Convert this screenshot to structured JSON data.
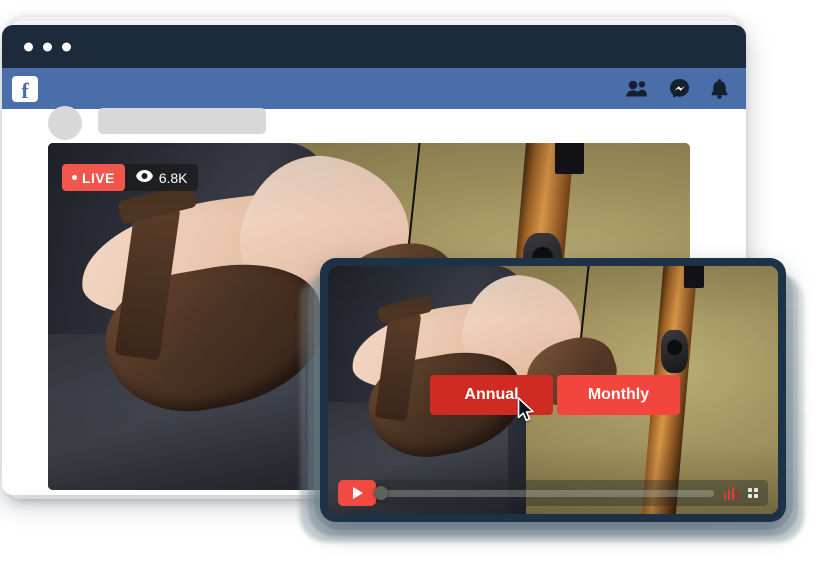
{
  "browser": {
    "window_controls": [
      "dot-1",
      "dot-2",
      "dot-3"
    ],
    "facebook_bar": {
      "logo_letter": "f",
      "icons": [
        "friends-icon",
        "messenger-icon",
        "notifications-bell-icon"
      ]
    },
    "skeleton": {
      "avatar": "avatar-placeholder",
      "name_bar": "name-placeholder"
    },
    "video": {
      "live_badge": {
        "label": "LIVE",
        "indicator": "live-dot",
        "color": "#f2554b"
      },
      "views": {
        "icon": "eye-icon",
        "count": "6.8K"
      },
      "alt": "archer-holding-bow-and-arrow"
    }
  },
  "device": {
    "bezel_color": "#1d3246",
    "video": {
      "alt": "archer-holding-bow-and-arrow"
    },
    "plan_buttons": [
      {
        "label": "Annual",
        "color": "#d02b22",
        "state": "hovered"
      },
      {
        "label": "Monthly",
        "color": "#f2453d",
        "state": "default"
      }
    ],
    "cursor": "mouse-pointer",
    "player_controls": {
      "play": "play-icon",
      "progress": "progress-track",
      "volume": "volume-bars-icon",
      "fullscreen": "fullscreen-icon",
      "accent": "#f04a42"
    }
  }
}
